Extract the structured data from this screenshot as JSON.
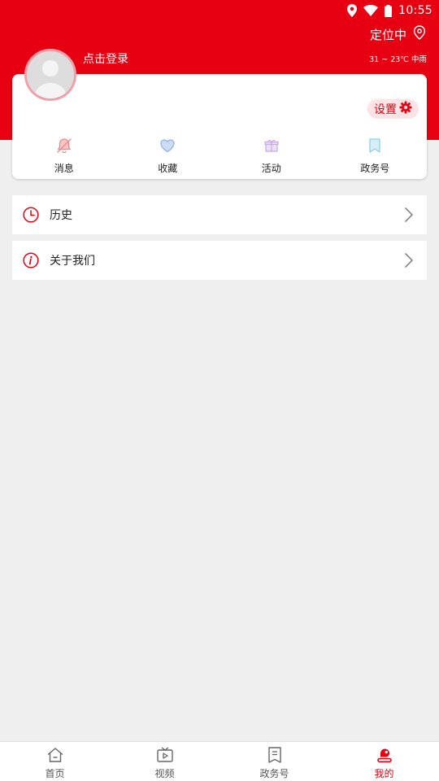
{
  "status_bar": {
    "time": "10:55"
  },
  "header": {
    "location_text": "定位中",
    "weather": "31 ~ 23℃ 中雨",
    "login_text": "点击登录"
  },
  "profile": {
    "settings_label": "设置",
    "quick_actions": [
      {
        "label": "消息",
        "icon": "bell-off-icon",
        "color": "#f08a8a"
      },
      {
        "label": "收藏",
        "icon": "heart-icon",
        "color": "#8fb3e6"
      },
      {
        "label": "活动",
        "icon": "gift-icon",
        "color": "#c9a8e6"
      },
      {
        "label": "政务号",
        "icon": "bookmark-icon",
        "color": "#8fd0e6"
      }
    ]
  },
  "menu": [
    {
      "label": "历史",
      "icon": "clock-icon"
    },
    {
      "label": "关于我们",
      "icon": "info-icon"
    }
  ],
  "bottom_nav": {
    "active_index": 3,
    "items": [
      {
        "label": "首页",
        "icon": "home-icon"
      },
      {
        "label": "视频",
        "icon": "tv-icon"
      },
      {
        "label": "政务号",
        "icon": "document-icon"
      },
      {
        "label": "我的",
        "icon": "user-icon"
      }
    ]
  },
  "colors": {
    "brand_red": "#e60012",
    "background": "#efefef"
  }
}
